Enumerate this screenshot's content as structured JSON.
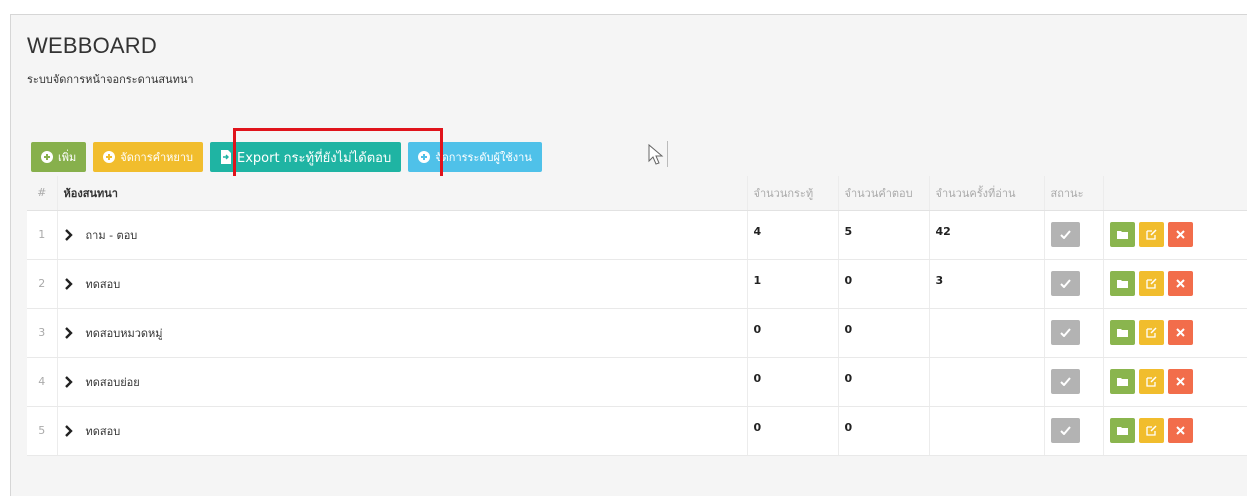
{
  "page": {
    "title": "WEBBOARD",
    "subtitle": "ระบบจัดการหน้าจอกระดานสนทนา"
  },
  "toolbar": {
    "add_label": "เพิ่ม",
    "manage_words_label": "จัดการคำหยาบ",
    "export_label": "Export กระทู้ที่ยังไม่ได้ตอบ",
    "manage_levels_label": "จัดการระดับผู้ใช้งาน"
  },
  "table": {
    "headers": {
      "index": "#",
      "room": "ห้องสนทนา",
      "topics": "จำนวนกระทู้",
      "replies": "จำนวนคำตอบ",
      "views": "จำนวนครั้งที่อ่าน",
      "status": "สถานะ"
    },
    "rows": [
      {
        "index": "1",
        "room": "ถาม - ตอบ",
        "topics": "4",
        "replies": "5",
        "views": "42"
      },
      {
        "index": "2",
        "room": "ทดสอบ",
        "topics": "1",
        "replies": "0",
        "views": "3"
      },
      {
        "index": "3",
        "room": "ทดสอบหมวดหมู่",
        "topics": "0",
        "replies": "0",
        "views": ""
      },
      {
        "index": "4",
        "room": "ทดสอบย่อย",
        "topics": "0",
        "replies": "0",
        "views": ""
      },
      {
        "index": "5",
        "room": "ทดสอบ",
        "topics": "0",
        "replies": "0",
        "views": ""
      }
    ]
  },
  "colors": {
    "green": "#87b04c",
    "yellow": "#f1bd2d",
    "teal": "#1fb4a3",
    "blue": "#4fc1e9",
    "red": "#f26d4b",
    "highlight": "#e0131b"
  },
  "icons": {
    "add": "plus-circle-icon",
    "export": "file-export-icon",
    "expand": "chevron-right-icon",
    "status": "check-icon",
    "open": "folder-icon",
    "edit": "edit-icon",
    "delete": "close-icon"
  }
}
